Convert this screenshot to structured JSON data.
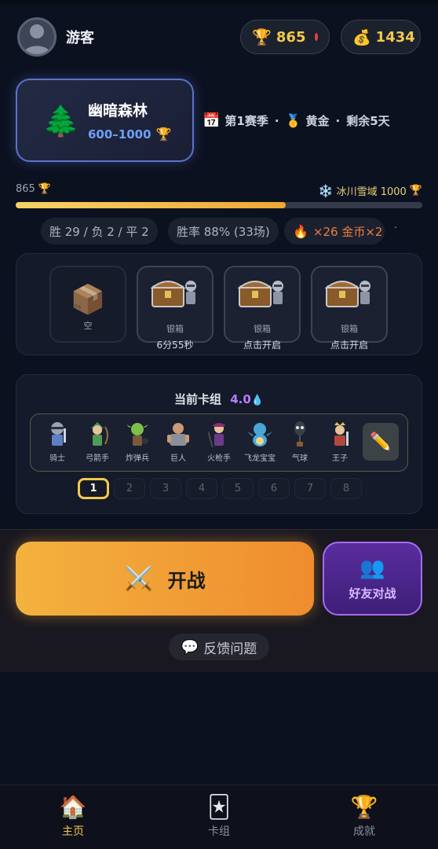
{
  "header": {
    "username": "游客",
    "trophies": "865",
    "gold": "1434"
  },
  "arena": {
    "name": "幽暗森林",
    "range": "600–1000"
  },
  "season": {
    "label": "第1赛季",
    "tier": "黄金",
    "remaining": "剩余5天",
    "sep": "·"
  },
  "progress": {
    "current": "865",
    "next_arena": "冰川雪域 1000",
    "fraction": 0.665
  },
  "stats": {
    "record": "胜 29 / 负 2 / 平 2",
    "winrate": "胜率 88% (33场)",
    "streak": "×26 金币×2",
    "more": "·"
  },
  "chests": [
    {
      "label": "空",
      "sub": ""
    },
    {
      "label": "银箱",
      "sub": "6分55秒"
    },
    {
      "label": "银箱",
      "sub": "点击开启"
    },
    {
      "label": "银箱",
      "sub": "点击开启"
    }
  ],
  "deck": {
    "title": "当前卡组",
    "elixir": "4.0",
    "cards": [
      "骑士",
      "弓箭手",
      "炸弹兵",
      "巨人",
      "火枪手",
      "飞龙宝宝",
      "气球",
      "王子"
    ],
    "slots": [
      "1",
      "2",
      "3",
      "4",
      "5",
      "6",
      "7",
      "8"
    ],
    "active_slot": "1"
  },
  "actions": {
    "battle": "开战",
    "friend_battle": "好友对战",
    "feedback": "反馈问题"
  },
  "nav": {
    "home": "主页",
    "cards": "卡组",
    "achievements": "成就"
  },
  "colors": {
    "accent_gold": "#f2c94c",
    "battle_orange": "#ef8c2e",
    "friend_purple": "#a56cf0",
    "arena_blue": "#5b73c9"
  }
}
